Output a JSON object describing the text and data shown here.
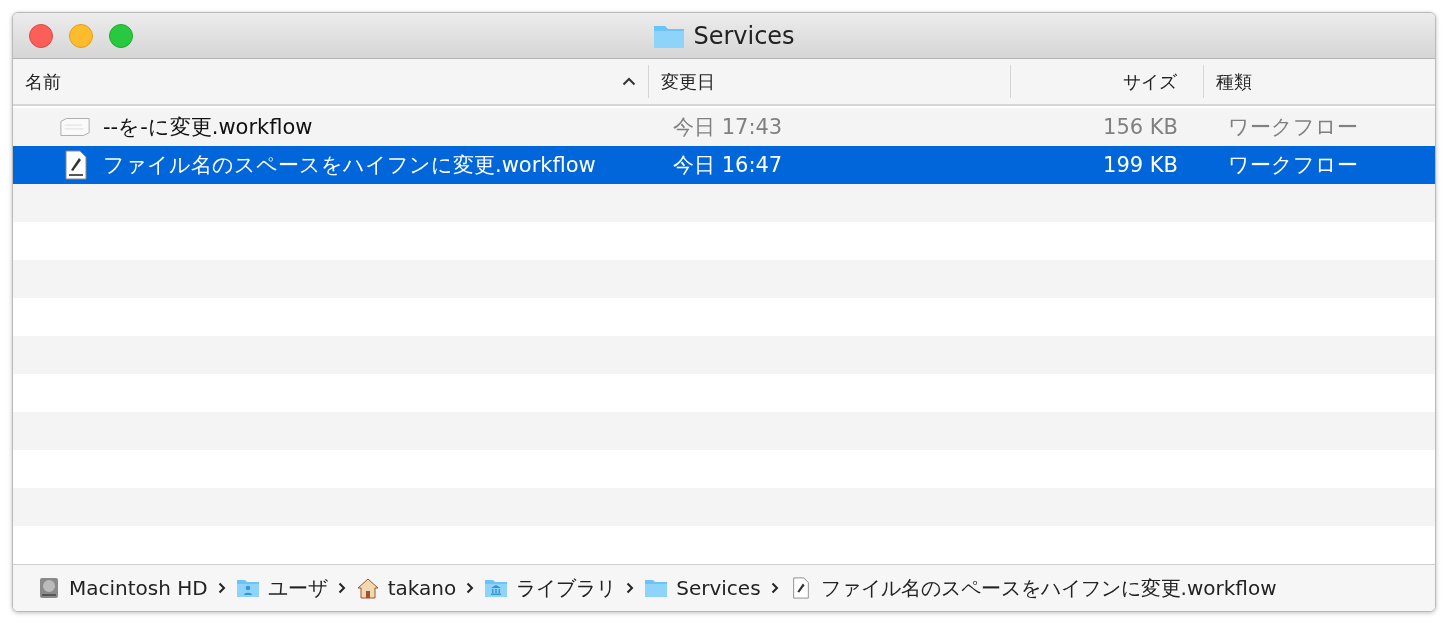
{
  "window": {
    "title": "Services"
  },
  "table": {
    "columns": [
      {
        "label": "名前",
        "sorted": true
      },
      {
        "label": "変更日",
        "sorted": false
      },
      {
        "label": "サイズ",
        "sorted": false
      },
      {
        "label": "種類",
        "sorted": false
      }
    ],
    "rows": [
      {
        "kind": "plain",
        "name": "--を-に変更.workflow",
        "date": "今日 17:43",
        "size": "156 KB",
        "file_type": "ワークフロー",
        "selected": false
      },
      {
        "kind": "wflow",
        "name": "ファイル名のスペースをハイフンに変更.workflow",
        "date": "今日 16:47",
        "size": "199 KB",
        "file_type": "ワークフロー",
        "selected": true
      }
    ]
  },
  "path_bar": [
    {
      "kind": "disk",
      "label": "Macintosh HD"
    },
    {
      "kind": "user-folder",
      "label": "ユーザ"
    },
    {
      "kind": "home",
      "label": "takano"
    },
    {
      "kind": "library-folder",
      "label": "ライブラリ"
    },
    {
      "kind": "folder",
      "label": "Services"
    },
    {
      "kind": "wflow",
      "label": "ファイル名のスペースをハイフンに変更.workflow"
    }
  ]
}
